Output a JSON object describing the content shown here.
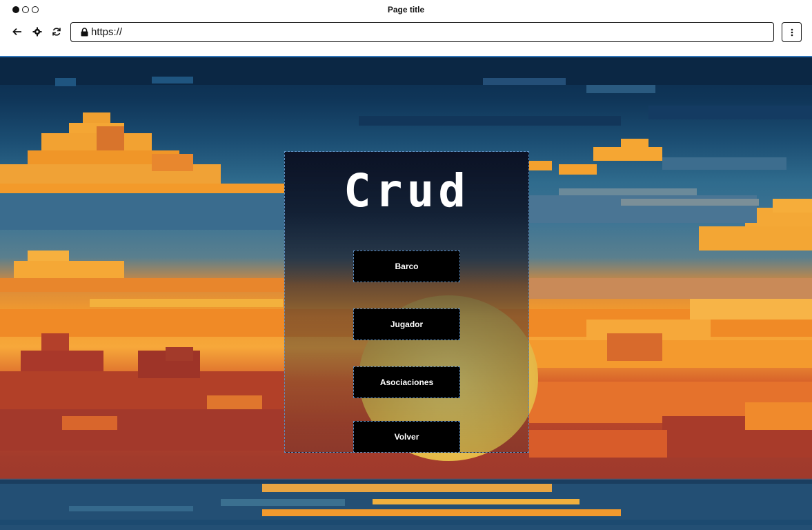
{
  "browser": {
    "page_title": "Page title",
    "url": "https://"
  },
  "crud": {
    "title": "Crud",
    "buttons": [
      {
        "label": "Barco"
      },
      {
        "label": "Jugador"
      },
      {
        "label": "Asociaciones"
      },
      {
        "label": "Volver"
      }
    ]
  },
  "colors": {
    "chrome_accent": "#2f74b8",
    "button_bg": "#000000",
    "button_text": "#ffffff",
    "sky_top": "#0c2b4b",
    "cloud_orange": "#f29a2e",
    "sun_yellow": "#f4e070"
  }
}
